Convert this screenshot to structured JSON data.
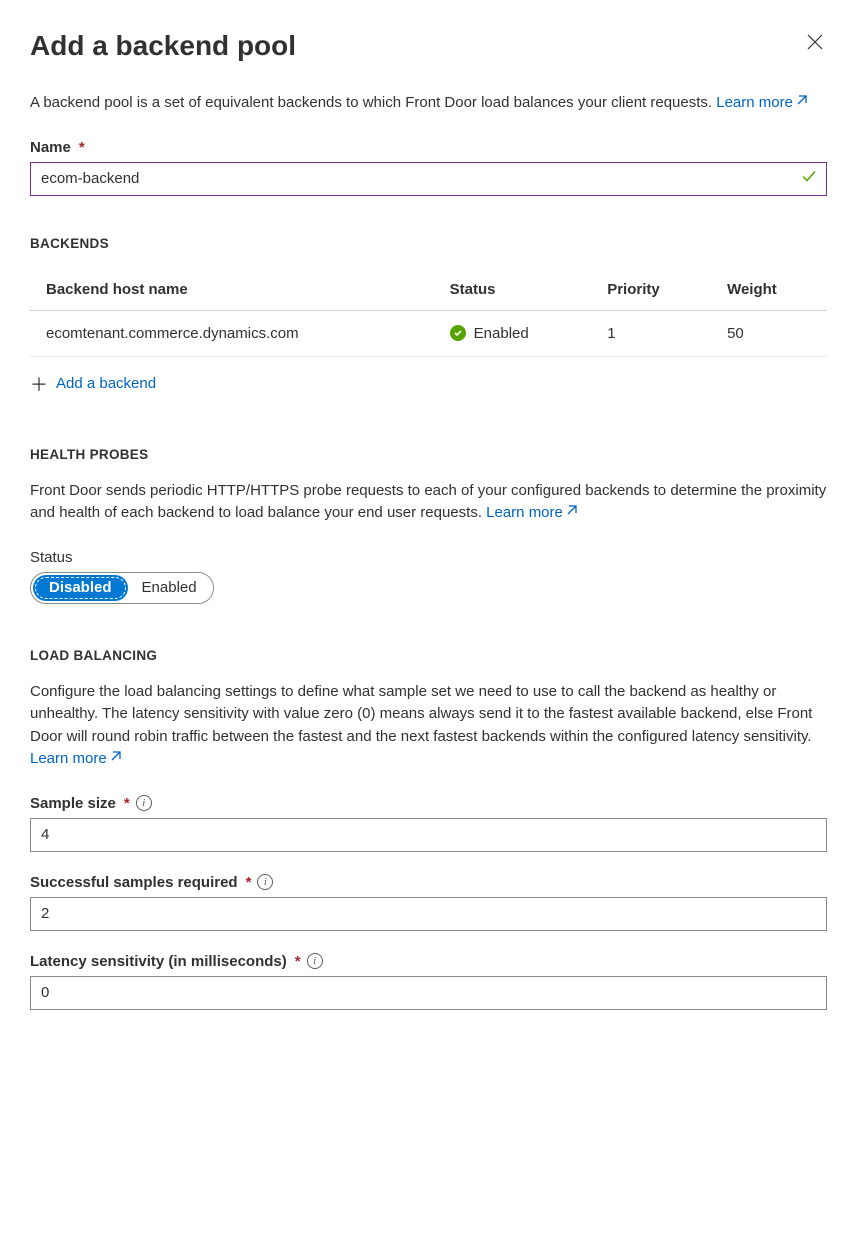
{
  "header": {
    "title": "Add a backend pool"
  },
  "intro": {
    "text": "A backend pool is a set of equivalent backends to which Front Door load balances your client requests. ",
    "learn_more": "Learn more"
  },
  "name_field": {
    "label": "Name",
    "value": "ecom-backend"
  },
  "backends": {
    "heading": "BACKENDS",
    "columns": {
      "host": "Backend host name",
      "status": "Status",
      "priority": "Priority",
      "weight": "Weight"
    },
    "rows": [
      {
        "host": "ecomtenant.commerce.dynamics.com",
        "status": "Enabled",
        "priority": "1",
        "weight": "50"
      }
    ],
    "add_label": "Add a backend"
  },
  "health_probes": {
    "heading": "HEALTH PROBES",
    "description": "Front Door sends periodic HTTP/HTTPS probe requests to each of your configured backends to determine the proximity and health of each backend to load balance your end user requests. ",
    "learn_more": "Learn more",
    "status_label": "Status",
    "toggle": {
      "disabled": "Disabled",
      "enabled": "Enabled"
    }
  },
  "load_balancing": {
    "heading": "LOAD BALANCING",
    "description": "Configure the load balancing settings to define what sample set we need to use to call the backend as healthy or unhealthy. The latency sensitivity with value zero (0) means always send it to the fastest available backend, else Front Door will round robin traffic between the fastest and the next fastest backends within the configured latency sensitivity. ",
    "learn_more": "Learn more",
    "sample_size": {
      "label": "Sample size",
      "value": "4"
    },
    "successful_samples": {
      "label": "Successful samples required",
      "value": "2"
    },
    "latency": {
      "label": "Latency sensitivity (in milliseconds)",
      "value": "0"
    }
  }
}
